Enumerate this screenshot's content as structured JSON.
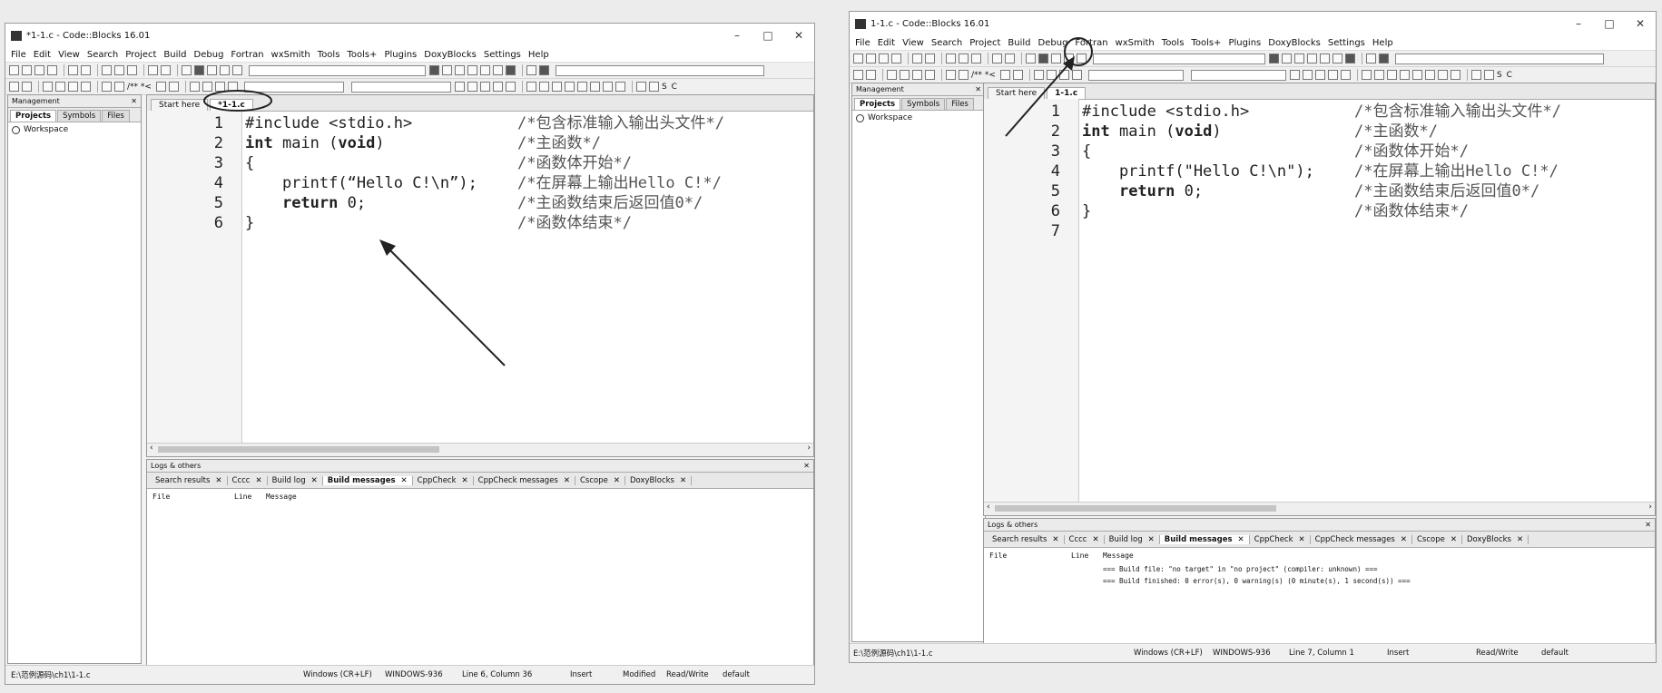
{
  "left": {
    "title": "*1-1.c - Code::Blocks 16.01",
    "tabs": [
      "Start here",
      "*1-1.c"
    ],
    "status": {
      "path": "E:\\范例源码\\ch1\\1-1.c",
      "eol": "Windows (CR+LF)",
      "encoding": "WINDOWS-936",
      "position": "Line 6, Column 36",
      "mode": "Insert",
      "modified": "Modified",
      "access": "Read/Write",
      "profile": "default"
    }
  },
  "right": {
    "title": "1-1.c - Code::Blocks 16.01",
    "tabs": [
      "Start here",
      "1-1.c"
    ],
    "build_messages": [
      "=== Build file: \"no target\" in \"no project\" (compiler: unknown) ===",
      "=== Build finished: 0 error(s), 0 warning(s) (0 minute(s), 1 second(s)) ==="
    ],
    "status": {
      "path": "E:\\范例源码\\ch1\\1-1.c",
      "eol": "Windows (CR+LF)",
      "encoding": "WINDOWS-936",
      "position": "Line 7, Column 1",
      "mode": "Insert",
      "modified": "",
      "access": "Read/Write",
      "profile": "default"
    }
  },
  "window_controls": {
    "minimize": "–",
    "maximize": "□",
    "close": "✕"
  },
  "menu": [
    "File",
    "Edit",
    "View",
    "Search",
    "Project",
    "Build",
    "Debug",
    "Fortran",
    "wxSmith",
    "Tools",
    "Tools+",
    "Plugins",
    "DoxyBlocks",
    "Settings",
    "Help"
  ],
  "toolbar_glyphs": {
    "comment": "/** *<",
    "spell": "S",
    "copyright": "C"
  },
  "management": {
    "title": "Management",
    "close": "✕",
    "tabs": [
      "Projects",
      "Symbols",
      "Files"
    ],
    "workspace": "Workspace"
  },
  "logs": {
    "title": "Logs & others",
    "close": "✕",
    "tabs": [
      "Search results",
      "Cccc",
      "Build log",
      "Build messages",
      "CppCheck",
      "CppCheck messages",
      "Cscope",
      "DoxyBlocks"
    ],
    "active_tab": "Build messages",
    "headers": {
      "file": "File",
      "line": "Line",
      "message": "Message"
    }
  },
  "code_left": [
    {
      "n": "1",
      "code": "#include <stdio.h>",
      "comment": "/*包含标准输入输出头文件*/"
    },
    {
      "n": "2",
      "kw": "int",
      "code": " main (",
      "kw2": "void",
      "code2": ")",
      "comment": "/*主函数*/"
    },
    {
      "n": "3",
      "code": "{",
      "comment": "/*函数体开始*/"
    },
    {
      "n": "4",
      "code": "    printf(“Hello C!\\n”);",
      "comment": "/*在屏幕上输出Hello C!*/"
    },
    {
      "n": "5",
      "code": "    ",
      "kw": "return",
      "code2": " 0;",
      "comment": "/*主函数结束后返回值0*/"
    },
    {
      "n": "6",
      "code": "}",
      "comment": "/*函数体结束*/"
    }
  ],
  "code_right": [
    {
      "n": "1",
      "code": "#include <stdio.h>",
      "comment": "/*包含标准输入输出头文件*/"
    },
    {
      "n": "2",
      "kw": "int",
      "code": " main (",
      "kw2": "void",
      "code2": ")",
      "comment": "/*主函数*/"
    },
    {
      "n": "3",
      "code": "{",
      "comment": "/*函数体开始*/"
    },
    {
      "n": "4",
      "code": "    printf(\"Hello C!\\n\");",
      "comment": "/*在屏幕上输出Hello C!*/"
    },
    {
      "n": "5",
      "code": "    ",
      "kw": "return",
      "code2": " 0;",
      "comment": "/*主函数结束后返回值0*/"
    },
    {
      "n": "6",
      "code": "}",
      "comment": "/*函数体结束*/"
    },
    {
      "n": "7",
      "code": "",
      "comment": ""
    }
  ]
}
